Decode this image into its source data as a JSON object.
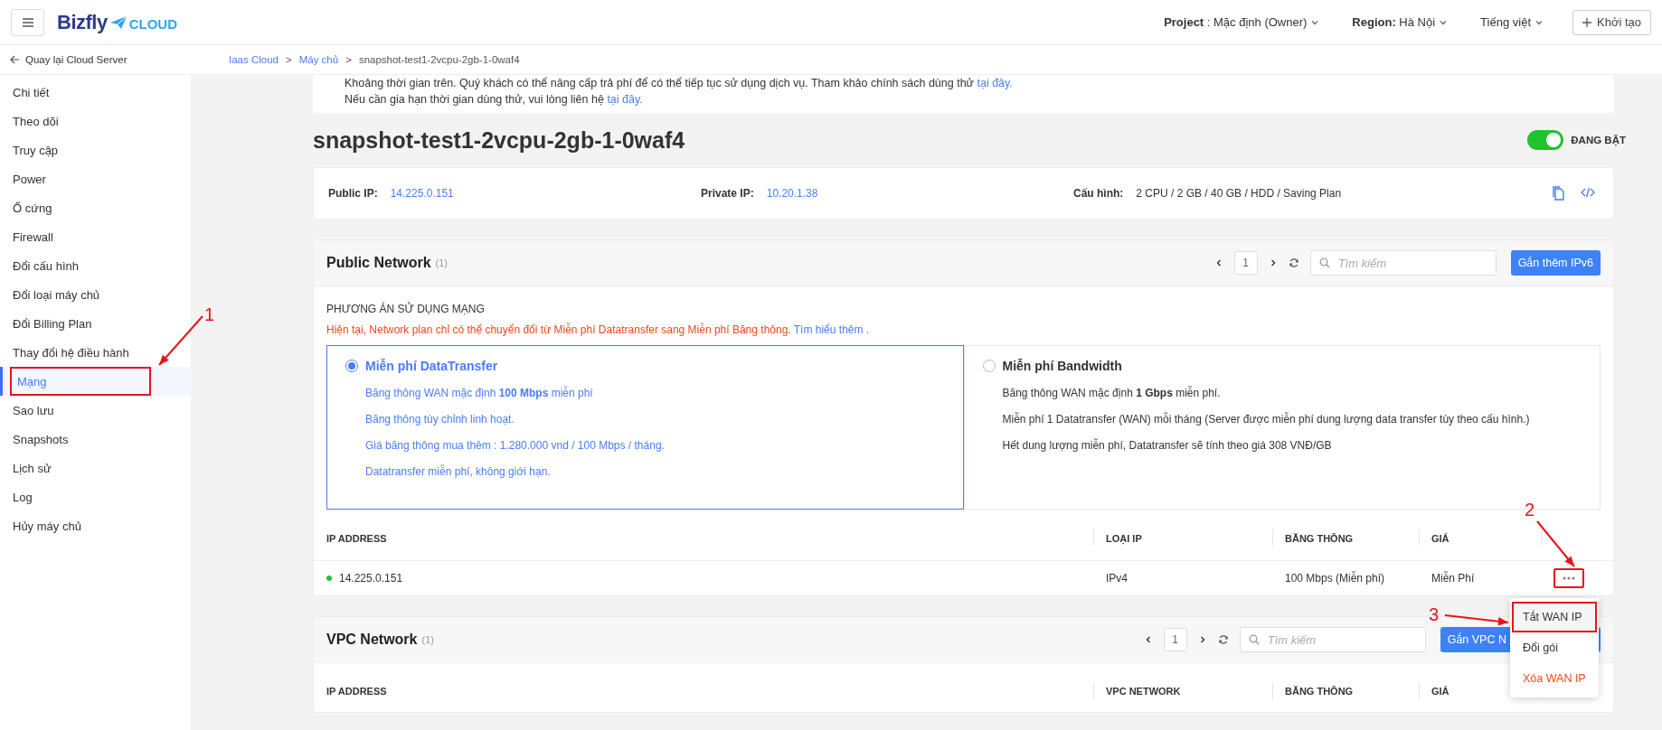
{
  "header": {
    "logo_text": "Bizfly",
    "logo_sub": "CLOUD",
    "project_label": "Project",
    "project_value": ": Mặc định (Owner)",
    "region_label": "Region:",
    "region_value": "Hà Nội",
    "language": "Tiếng việt",
    "create_button": "Khởi tạo"
  },
  "back_link": "Quay lại Cloud Server",
  "breadcrumb": [
    {
      "label": "Iaas Cloud",
      "kind": "link"
    },
    {
      "label": ">",
      "kind": "sep"
    },
    {
      "label": "Máy chủ",
      "kind": "link"
    },
    {
      "label": ">",
      "kind": "sep"
    },
    {
      "label": "snapshot-test1-2vcpu-2gb-1-0waf4",
      "kind": "current"
    }
  ],
  "sidebar": {
    "items": [
      {
        "label": "Chi tiết",
        "selected": false,
        "annotated": false
      },
      {
        "label": "Theo dõi",
        "selected": false,
        "annotated": false
      },
      {
        "label": "Truy cập",
        "selected": false,
        "annotated": false
      },
      {
        "label": "Power",
        "selected": false,
        "annotated": false
      },
      {
        "label": "Ổ cứng",
        "selected": false,
        "annotated": false
      },
      {
        "label": "Firewall",
        "selected": false,
        "annotated": false
      },
      {
        "label": "Đổi cấu hình",
        "selected": false,
        "annotated": false
      },
      {
        "label": "Đổi loại máy chủ",
        "selected": false,
        "annotated": false
      },
      {
        "label": "Đổi Billing Plan",
        "selected": false,
        "annotated": false
      },
      {
        "label": "Thay đổi hệ điều hành",
        "selected": false,
        "annotated": false
      },
      {
        "label": "Mạng",
        "selected": true,
        "annotated": true
      },
      {
        "label": "Sao lưu",
        "selected": false,
        "annotated": false
      },
      {
        "label": "Snapshots",
        "selected": false,
        "annotated": false
      },
      {
        "label": "Lịch sử",
        "selected": false,
        "annotated": false
      },
      {
        "label": "Log",
        "selected": false,
        "annotated": false
      },
      {
        "label": "Hủy máy chủ",
        "selected": false,
        "annotated": false
      }
    ]
  },
  "notice": {
    "lines": [
      {
        "text": "Khoảng thời gian trên. Quý khách có thể nâng cấp trả phí để có thể tiếp tục sử dụng dịch vụ. Tham khảo chính sách dùng thử",
        "link": "tại đây."
      },
      {
        "text": "Nếu cần gia hạn thời gian dùng thử, vui lòng liên hệ",
        "link": "tại đây."
      }
    ]
  },
  "server": {
    "name": "snapshot-test1-2vcpu-2gb-1-0waf4",
    "power": {
      "on": true,
      "label": "ĐANG BẬT"
    }
  },
  "info": [
    {
      "label": "Public IP:",
      "value": "14.225.0.151",
      "kind": "link"
    },
    {
      "label": "Private IP:",
      "value": "10.20.1.38",
      "kind": "link"
    },
    {
      "label": "Cấu hình:",
      "value": "2 CPU / 2 GB / 40 GB / HDD / Saving Plan",
      "kind": "plain"
    }
  ],
  "public_network": {
    "title": "Public Network",
    "count": "(1)",
    "page": "1",
    "search_placeholder": "Tìm kiếm",
    "button": "Gắn thêm IPv6",
    "plan_heading": "PHƯƠNG ÁN SỬ DỤNG MẠNG",
    "plan_note": "Hiện tại, Network plan chỉ có thể chuyển đổi từ Miễn phí Datatransfer sang Miễn phí Băng thông.",
    "plan_note_link": "Tìm hiểu thêm .",
    "plans": [
      {
        "title": "Miễn phí DataTransfer",
        "selected": true,
        "lines": [
          "Băng thông WAN mặc định **100 Mbps** miễn phí",
          "Băng thông tùy chỉnh linh hoạt.",
          "Giá băng thông mua thêm : 1.280.000 vnd / 100 Mbps / tháng.",
          "Datatransfer miễn phí, không giới hạn."
        ]
      },
      {
        "title": "Miễn phí Bandwidth",
        "selected": false,
        "lines": [
          "Băng thông WAN mặc định **1 Gbps** miễn phí.",
          "Miễn phí 1 Datatransfer (WAN) mỗi tháng (Server được miễn phí dung lượng data transfer tùy theo cấu hình.)",
          "Hết dung lượng miễn phí, Datatransfer sẽ tính theo giá 308 VNĐ/GB"
        ]
      }
    ],
    "columns": [
      "IP ADDRESS",
      "LOẠI IP",
      "BĂNG THÔNG",
      "GIÁ"
    ],
    "rows": [
      {
        "color": "#1fc32e",
        "cells": [
          "14.225.0.151",
          "IPv4",
          "100 Mbps (Miễn phí)",
          "Miễn Phí"
        ],
        "annotated": true
      }
    ]
  },
  "row_menu": {
    "items": [
      {
        "label": "Tắt WAN IP",
        "kind": "normal",
        "annotated": true
      },
      {
        "label": "Đổi gói",
        "kind": "normal",
        "annotated": false
      },
      {
        "label": "Xóa WAN IP",
        "kind": "danger",
        "annotated": false
      }
    ]
  },
  "vpc_network": {
    "title": "VPC Network",
    "count": "(1)",
    "page": "1",
    "search_placeholder": "Tìm kiếm",
    "button": "Gắn VPC N",
    "columns": [
      "IP ADDRESS",
      "VPC NETWORK",
      "BĂNG THÔNG",
      "GIÁ"
    ]
  },
  "annotations": [
    {
      "label": "1"
    },
    {
      "label": "2"
    },
    {
      "label": "3"
    }
  ]
}
